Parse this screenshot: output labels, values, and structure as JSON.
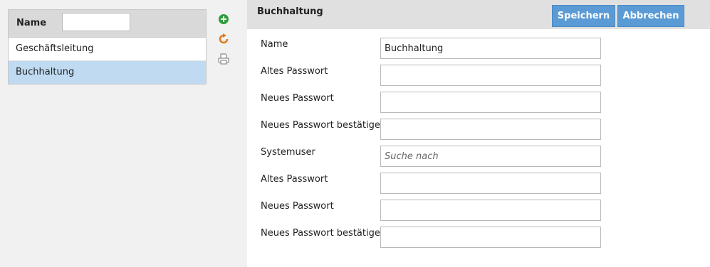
{
  "list": {
    "header_label": "Name",
    "filter_value": "",
    "rows": [
      {
        "label": "Geschäftsleitung"
      },
      {
        "label": "Buchhaltung"
      }
    ]
  },
  "tools": {
    "add_icon": "plus-circle-icon",
    "refresh_icon": "refresh-icon",
    "print_icon": "printer-icon",
    "colors": {
      "add": "#2e9e3a",
      "refresh": "#e07b1f",
      "print": "#8a8a8a"
    }
  },
  "form": {
    "title": "Buchhaltung",
    "save_label": "Speichern",
    "cancel_label": "Abbrechen",
    "fields": [
      {
        "label": "Name",
        "value": "Buchhaltung",
        "placeholder": ""
      },
      {
        "label": "Altes Passwort",
        "value": "",
        "placeholder": ""
      },
      {
        "label": "Neues Passwort",
        "value": "",
        "placeholder": ""
      },
      {
        "label": "Neues Passwort bestätigen",
        "value": "",
        "placeholder": ""
      },
      {
        "label": "Systemuser",
        "value": "",
        "placeholder": "Suche nach"
      },
      {
        "label": "Altes Passwort",
        "value": "",
        "placeholder": ""
      },
      {
        "label": "Neues Passwort",
        "value": "",
        "placeholder": ""
      },
      {
        "label": "Neues Passwort bestätigen",
        "value": "",
        "placeholder": ""
      }
    ]
  },
  "colors": {
    "button": "#5b9bd5",
    "selected_row": "#bfdaf1",
    "header_bg": "#d9d9d9"
  }
}
